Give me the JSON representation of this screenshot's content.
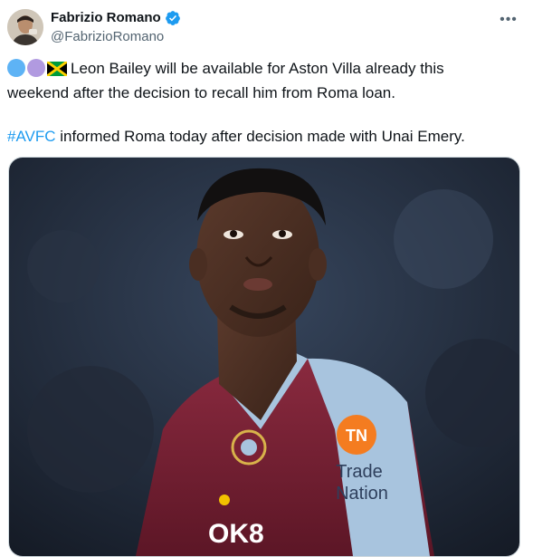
{
  "author": {
    "name": "Fabrizio Romano",
    "handle": "@FabrizioRomano",
    "verified": true
  },
  "tweet": {
    "line1": "Leon Bailey will be available for Aston Villa already this",
    "line2": "weekend after the decision to recall him from Roma loan.",
    "hashtag": "#AVFC",
    "line3": "informed Roma today after decision made with Unai Emery."
  },
  "media": {
    "sponsor_line1": "Trade",
    "sponsor_line2": "Nation",
    "shirt_text": "OK8"
  },
  "colors": {
    "accent": "#1d9bf0",
    "secondary_text": "#536471",
    "claret": "#7b2134",
    "sky_blue": "#a8c4de"
  },
  "icons": [
    "verified-badge-icon",
    "more-options-icon",
    "blue-circle-emoji",
    "purple-circle-emoji",
    "jamaica-flag-emoji"
  ]
}
